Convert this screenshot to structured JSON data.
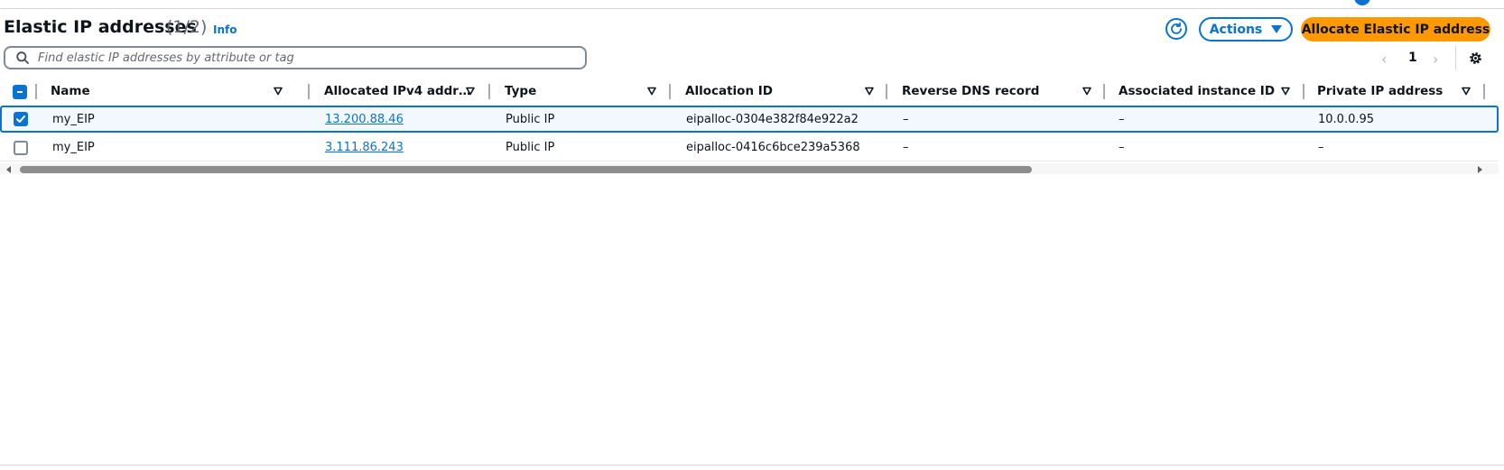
{
  "header": {
    "title": "Elastic IP addresses",
    "count": "(1/2)",
    "info_label": "Info"
  },
  "toolbar": {
    "refresh_icon": "refresh-icon",
    "actions_label": "Actions",
    "allocate_label": "Allocate Elastic IP address"
  },
  "search": {
    "placeholder": "Find elastic IP addresses by attribute or tag",
    "value": ""
  },
  "pagination": {
    "current_page": "1"
  },
  "table": {
    "columns": [
      "Name",
      "Allocated IPv4 addr…",
      "Type",
      "Allocation ID",
      "Reverse DNS record",
      "Associated instance ID",
      "Private IP address"
    ],
    "rows": [
      {
        "selected": true,
        "name": "my_EIP",
        "ipv4": "13.200.88.46",
        "type": "Public IP",
        "allocation_id": "eipalloc-0304e382f84e922a2",
        "reverse_dns": "–",
        "instance_id": "–",
        "private_ip": "10.0.0.95"
      },
      {
        "selected": false,
        "name": "my_EIP",
        "ipv4": "3.111.86.243",
        "type": "Public IP",
        "allocation_id": "eipalloc-0416c6bce239a5368",
        "reverse_dns": "–",
        "instance_id": "–",
        "private_ip": "–"
      }
    ]
  },
  "colors": {
    "accent": "#0972d3",
    "primary_button": "#ff9900",
    "selected_row_bg": "#f2f8fd"
  }
}
